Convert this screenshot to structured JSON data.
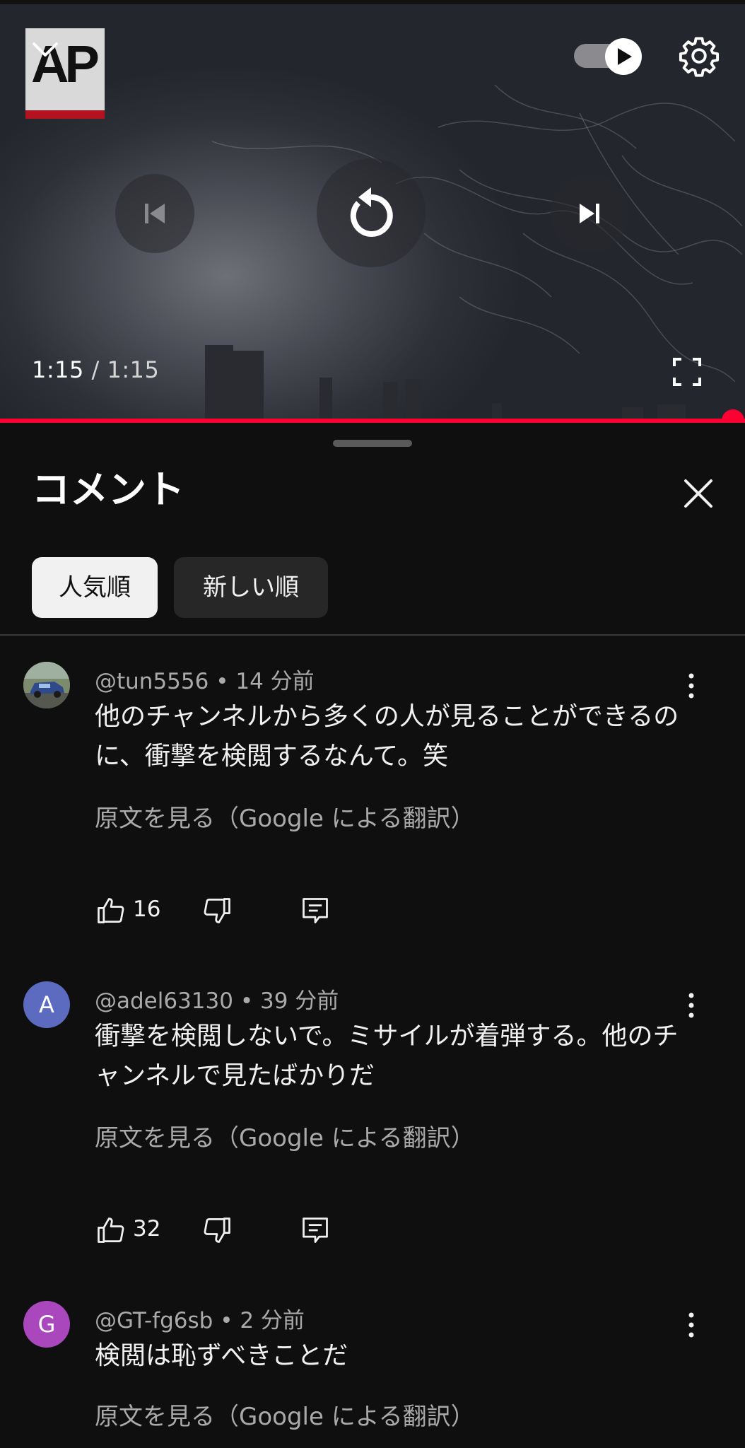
{
  "player": {
    "time_current": "1:15",
    "time_separator": " / ",
    "time_total": "1:15",
    "progress_fraction": 1.0,
    "logo_text": "AP",
    "autoplay_on": true,
    "accent_color": "#ff0033"
  },
  "comments_panel": {
    "title": "コメント",
    "sort_chips": [
      {
        "label": "人気順",
        "selected": true
      },
      {
        "label": "新しい順",
        "selected": false
      }
    ],
    "comments": [
      {
        "author": "@tun5556",
        "age": "14 分前",
        "avatar": "photo",
        "text": "他のチャンネルから多くの人が見ることができるのに、衝撃を検閲するなんて。笑",
        "translate_link": "原文を見る（Google による翻訳）",
        "likes": "16"
      },
      {
        "author": "@adel63130",
        "age": "39 分前",
        "avatar": "A",
        "avatar_color": "#5c6bc0",
        "text": "衝撃を検閲しないで。ミサイルが着弾する。他のチャンネルで見たばかりだ",
        "translate_link": "原文を見る（Google による翻訳）",
        "likes": "32"
      },
      {
        "author": "@GT-fg6sb",
        "age": "2 分前",
        "avatar": "G",
        "avatar_color": "#ab47bc",
        "text": "検閲は恥ずべきことだ",
        "translate_link": "原文を見る（Google による翻訳）"
      }
    ]
  },
  "icons": {
    "collapse": "chevron-down-icon",
    "settings": "gear-icon",
    "previous": "skip-previous-icon",
    "replay": "replay-icon",
    "next": "skip-next-icon",
    "fullscreen": "fullscreen-icon",
    "close": "close-icon",
    "more": "more-vert-icon",
    "like": "thumb-up-icon",
    "dislike": "thumb-down-icon",
    "reply": "reply-icon"
  }
}
